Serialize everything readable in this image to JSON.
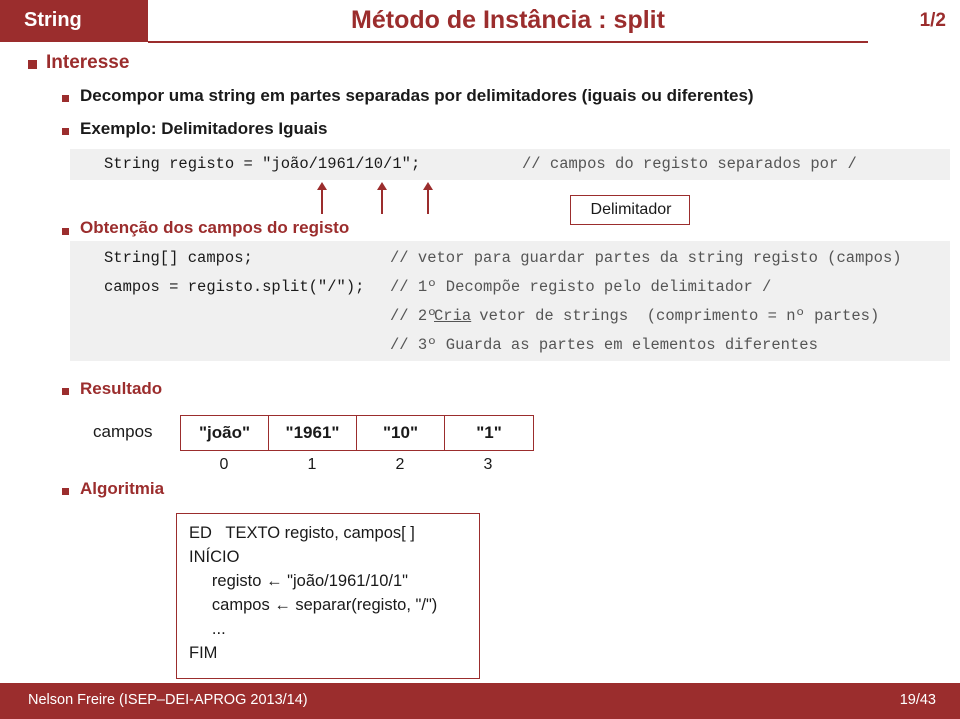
{
  "header": {
    "left_label": "String",
    "title": "Método de Instância : split",
    "page_indicator": "1/2"
  },
  "sections": {
    "interesse": "Interesse",
    "bullet1": "Decompor uma string em partes separadas por delimitadores (iguais ou diferentes)",
    "bullet2": "Exemplo: Delimitadores Iguais",
    "obtencao": "Obtenção dos campos do registo",
    "resultado": "Resultado",
    "algoritmia": "Algoritmia"
  },
  "code_block_1": {
    "declaration": "String registo = \"joão/1961/10/1\";",
    "comment": "// campos do registo separados por /"
  },
  "callout": {
    "delimitador": "Delimitador"
  },
  "code_block_2": {
    "line1_code": "String[] campos;",
    "line1_comment": "// vetor para guardar partes da string registo (campos)",
    "line2_code": "campos = registo.split(\"/\");",
    "line2_comment": "// 1º Decompõe registo pelo delimitador /",
    "line3_comment_a": "// 2º ",
    "line3_comment_b": "Cria",
    "line3_comment_c": " vetor de strings  (comprimento = nº partes)",
    "line4_comment": "// 3º Guarda as partes em elementos diferentes"
  },
  "result": {
    "label": "campos",
    "cells": [
      "\"joão\"",
      "\"1961\"",
      "\"10\"",
      "\"1\""
    ],
    "indices": [
      "0",
      "1",
      "2",
      "3"
    ]
  },
  "algorithm": {
    "lines": [
      "ED   TEXTO registo, campos[ ]",
      "INÍCIO",
      "     registo ← \"joão/1961/10/1\"",
      "     campos ← separar(registo, \"/\")",
      "     ...",
      "FIM"
    ]
  },
  "footer": {
    "left": "Nelson Freire (ISEP–DEI-APROG 2013/14)",
    "right": "19/43"
  },
  "colors": {
    "brand": "#9b2d2d",
    "code_bg": "#f0f0f0",
    "comment": "#555555"
  }
}
